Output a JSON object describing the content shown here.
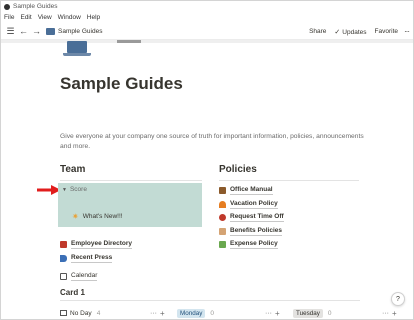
{
  "window": {
    "title": "Sample Guides"
  },
  "menu": [
    "File",
    "Edit",
    "View",
    "Window",
    "Help"
  ],
  "toolbar": {
    "breadcrumb": "Sample Guides",
    "share": "Share",
    "updates": "Updates",
    "favorite": "Favorite",
    "more": "···"
  },
  "page": {
    "title": "Sample Guides",
    "description": "Give everyone at your company one source of truth for important information, policies, announcements and more."
  },
  "team": {
    "heading": "Team",
    "toggle_label": "Score",
    "toggle_child": "What's New!!!",
    "links": [
      {
        "label": "Employee Directory",
        "icon": "directory-icon"
      },
      {
        "label": "Recent Press",
        "icon": "megaphone-icon"
      },
      {
        "label": "Calendar",
        "icon": "calendar-icon"
      }
    ]
  },
  "policies": {
    "heading": "Policies",
    "links": [
      {
        "label": "Office Manual",
        "icon": "manual-icon"
      },
      {
        "label": "Vacation Policy",
        "icon": "vacation-icon"
      },
      {
        "label": "Request Time Off",
        "icon": "request-icon"
      },
      {
        "label": "Benefits Policies",
        "icon": "benefits-icon"
      },
      {
        "label": "Expense Policy",
        "icon": "expense-icon"
      }
    ]
  },
  "board": {
    "heading": "Card 1",
    "columns": [
      {
        "label": "No Day",
        "count": "4"
      },
      {
        "label": "Monday",
        "count": "0"
      },
      {
        "label": "Tuesday",
        "count": "0"
      }
    ]
  },
  "help": "?",
  "colors": {
    "toggle_bg": "#c2dbd4",
    "arrow": "#e11d1d",
    "monday_tag": "#d3e5ef",
    "tuesday_tag": "#e3e2e0"
  }
}
